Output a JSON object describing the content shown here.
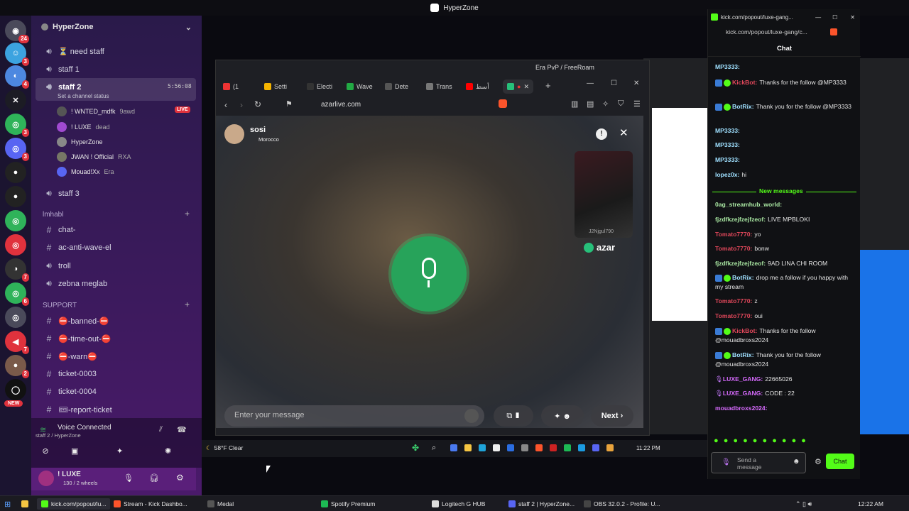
{
  "os_title": "HyperZone",
  "discord": {
    "server_name": "HyperZone",
    "rail_badges": [
      "24",
      "3",
      "4",
      "",
      "3",
      "3",
      "",
      "",
      "",
      "",
      "7",
      "6",
      "",
      "7",
      "2",
      "",
      "NEW"
    ],
    "channels": {
      "need_staff": "⏳ need staff",
      "staff1": "staff 1",
      "staff2": "staff 2",
      "staff2_time": "5:56:08",
      "staff2_status": "Set a channel status",
      "staff3": "staff 3"
    },
    "voice_users": [
      {
        "name": "! WNTED_mdfk",
        "tag": "9awd",
        "live": "LIVE"
      },
      {
        "name": "! LUXE",
        "tag": "dead"
      },
      {
        "name": "HyperZone",
        "tag": ""
      },
      {
        "name": "JWAN ! Official",
        "tag": "RXA"
      },
      {
        "name": "Mouad!Xx",
        "tag": "Era"
      }
    ],
    "cat_lmhabl": "lmhabl",
    "text_channels": [
      "chat-",
      "ac-anti-wave-el",
      "troll",
      "zebna meglab"
    ],
    "cat_support": "SUPPORT",
    "support_channels": [
      "⛔-banned-⛔",
      "⛔-time-out-⛔",
      "⛔-warn⛔",
      "ticket-0003",
      "ticket-0004",
      "🎟-report-ticket"
    ],
    "voice_connected": "Voice Connected",
    "voice_where": "staff 2 / HyperZone",
    "me": {
      "name": "! LUXE",
      "status": "130 / 2 wheels"
    }
  },
  "browser": {
    "window_title": "Era PvP / FreeRoam",
    "tabs": [
      "(1",
      "Setti",
      "Electi",
      "Wave",
      "Dete",
      "Trans",
      "أسط"
    ],
    "url": "azarlive.com",
    "peer": {
      "name": "sosi",
      "country": "Morocco"
    },
    "self_cam_label": "J2Njgul790",
    "brand": "azar",
    "message_placeholder": "Enter your message",
    "next_label": "Next ›"
  },
  "chat": {
    "title_url": "kick.com/popout/luxe-gang...",
    "addr": "kick.com/popout/luxe-gang/c...",
    "header": "Chat",
    "new_messages": "New messages",
    "messages": [
      {
        "u": "MP3333:",
        "t": "",
        "c": "bl"
      },
      {
        "u": "KickBot:",
        "t": "Thanks for the follow @MP3333",
        "c": "r"
      },
      {
        "u": "BotRix:",
        "t": "Thank you for the follow @MP3333",
        "c": "bl"
      },
      {
        "u": "MP3333:",
        "t": "",
        "c": "bl"
      },
      {
        "u": "MP3333:",
        "t": "",
        "c": "bl"
      },
      {
        "u": "MP3333:",
        "t": "",
        "c": "bl"
      },
      {
        "u": "lopez0x:",
        "t": "hi",
        "c": "bl"
      },
      {
        "u": "0ag_streamhub_world:",
        "t": "",
        "c": "g"
      },
      {
        "u": "fjzdfkzejfzejfzeof:",
        "t": "LIVE MPBLOKI",
        "c": "g"
      },
      {
        "u": "Tomato7770:",
        "t": "yo",
        "c": "r"
      },
      {
        "u": "Tomato7770:",
        "t": "bonw",
        "c": "r"
      },
      {
        "u": "fjzdfkzejfzejfzeof:",
        "t": "9AD LINA CHI ROOM",
        "c": "g"
      },
      {
        "u": "BotRix:",
        "t": "drop me a follow if you happy with my stream",
        "c": "bl"
      },
      {
        "u": "Tomato7770:",
        "t": "z",
        "c": "r"
      },
      {
        "u": "Tomato7770:",
        "t": "oui",
        "c": "r"
      },
      {
        "u": "KickBot:",
        "t": "Thanks for the follow @mouadbroxs2024",
        "c": "r"
      },
      {
        "u": "BotRix:",
        "t": "Thank you for the follow @mouadbroxs2024",
        "c": "bl"
      },
      {
        "u": "LUXE_GANG:",
        "t": "22665026",
        "c": "p"
      },
      {
        "u": "LUXE_GANG:",
        "t": "CODE : 22",
        "c": "p"
      },
      {
        "u": "mouadbroxs2024:",
        "t": "",
        "c": "p"
      }
    ],
    "send_placeholder": "Send a message",
    "send_btn": "Chat"
  },
  "weather": "58°F Clear",
  "inner_time": "11:22 PM",
  "taskbar": {
    "items": [
      "kick.com/popout/lu...",
      "Stream - Kick Dashbo...",
      "Medal",
      "Spotify Premium",
      "Logitech G HUB",
      "staff 2 | HyperZone...",
      "OBS 32.0.2 - Profile: U..."
    ],
    "time": "12:22 AM"
  },
  "colors": {
    "accent": "#53fc18",
    "azar_green": "#27a35a",
    "live_red": "#e0323d"
  }
}
